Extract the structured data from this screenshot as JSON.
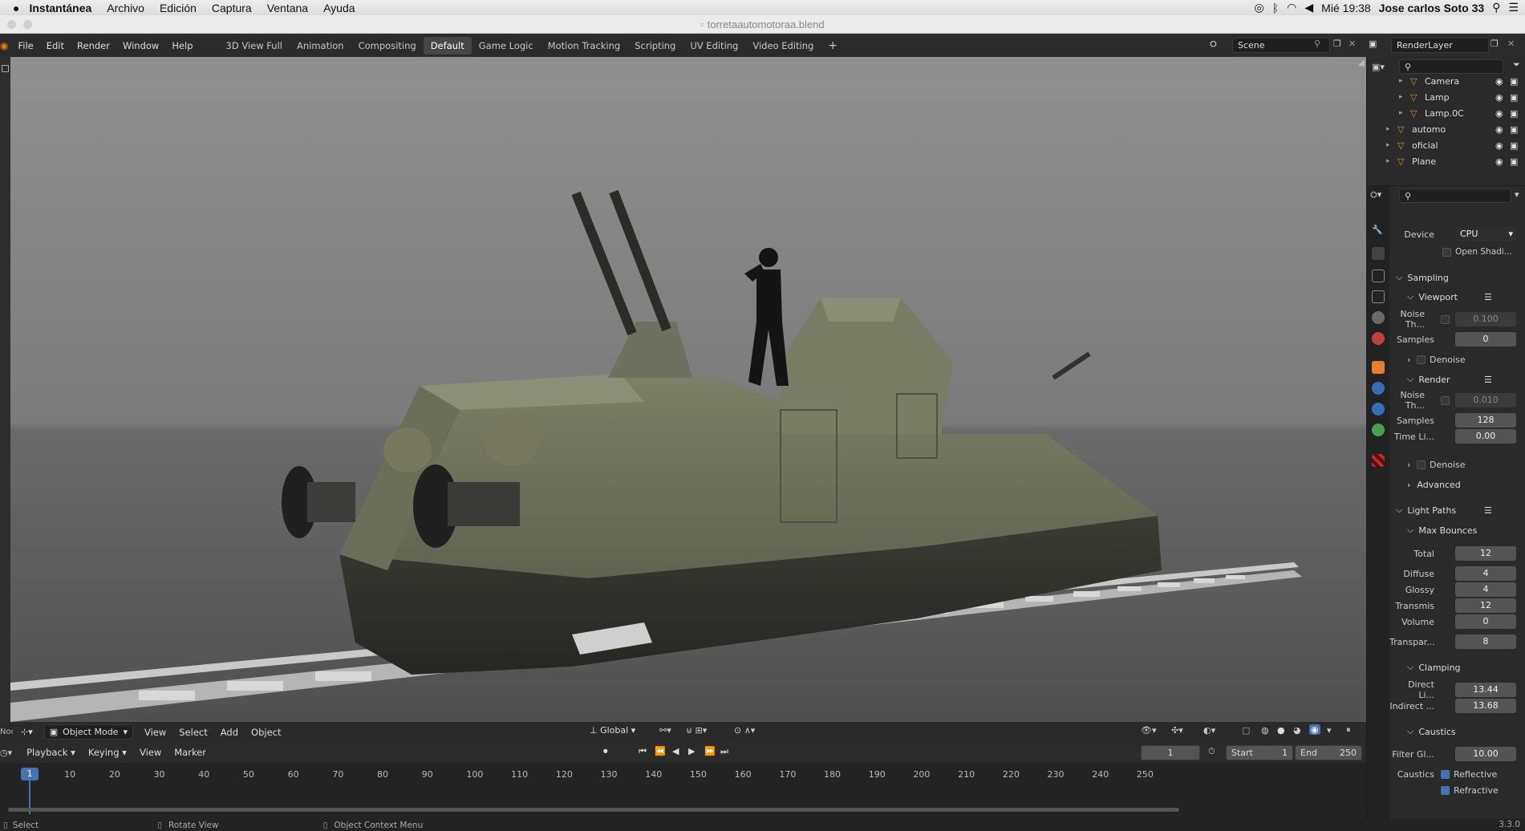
{
  "mac": {
    "app": "Instantánea",
    "menus": [
      "Archivo",
      "Edición",
      "Captura",
      "Ventana",
      "Ayuda"
    ],
    "clock": "Mié 19:38",
    "user": "Jose carlos Soto 33"
  },
  "window": {
    "title": "torretaautomotoraa.blend"
  },
  "topbar": {
    "menus": [
      "File",
      "Edit",
      "Render",
      "Window",
      "Help"
    ],
    "workspaces": [
      "3D View Full",
      "Animation",
      "Compositing",
      "Default",
      "Game Logic",
      "Motion Tracking",
      "Scripting",
      "UV Editing",
      "Video Editing"
    ],
    "active": "Default",
    "plus": "+",
    "scene": "Scene",
    "renderlayer": "RenderLayer"
  },
  "viewport_header": {
    "prefix": "Noc",
    "mode": "Object Mode",
    "menus": [
      "View",
      "Select",
      "Add",
      "Object"
    ],
    "transform": "Global"
  },
  "timeline": {
    "menus": [
      "Playback",
      "Keying",
      "View",
      "Marker"
    ],
    "current": "1",
    "start_label": "Start",
    "start": "1",
    "end_label": "End",
    "end": "250",
    "ticks": [
      "1",
      "10",
      "20",
      "30",
      "40",
      "50",
      "60",
      "70",
      "80",
      "90",
      "100",
      "110",
      "120",
      "130",
      "140",
      "150",
      "160",
      "170",
      "180",
      "190",
      "200",
      "210",
      "220",
      "230",
      "240",
      "250"
    ]
  },
  "status": {
    "select": "Select",
    "rotate": "Rotate View",
    "context": "Object Context Menu",
    "version": "3.3.0"
  },
  "outliner": {
    "rows": [
      {
        "name": "Camera",
        "indent": 2
      },
      {
        "name": "Lamp",
        "indent": 2
      },
      {
        "name": "Lamp.0C",
        "indent": 2
      },
      {
        "name": "automo",
        "indent": 1
      },
      {
        "name": "oficial",
        "indent": 1
      },
      {
        "name": "Plane",
        "indent": 1
      }
    ]
  },
  "props": {
    "device_label": "Device",
    "device": "CPU",
    "osl": "Open Shadi...",
    "sampling": "Sampling",
    "viewport": "Viewport",
    "vp_noise_label": "Noise Th...",
    "vp_noise": "0.100",
    "vp_samples_label": "Samples",
    "vp_samples": "0",
    "denoise": "Denoise",
    "render": "Render",
    "r_noise_label": "Noise Th...",
    "r_noise": "0.010",
    "r_samples_label": "Samples",
    "r_samples": "128",
    "time_label": "Time Li...",
    "time": "0.00",
    "denoise2": "Denoise",
    "advanced": "Advanced",
    "light_paths": "Light Paths",
    "max_bounces": "Max Bounces",
    "total_label": "Total",
    "total": "12",
    "diffuse_label": "Diffuse",
    "diffuse": "4",
    "glossy_label": "Glossy",
    "glossy": "4",
    "transmis_label": "Transmis",
    "transmis": "12",
    "volume_label": "Volume",
    "volume": "0",
    "transpar_label": "Transpar...",
    "transpar": "8",
    "clamping": "Clamping",
    "direct_label": "Direct Li...",
    "direct": "13.44",
    "indirect_label": "Indirect ...",
    "indirect": "13.68",
    "caustics": "Caustics",
    "filter_label": "Filter Gl...",
    "filter": "10.00",
    "caustics_label": "Caustics",
    "reflective": "Reflective",
    "refractive": "Refractive"
  }
}
